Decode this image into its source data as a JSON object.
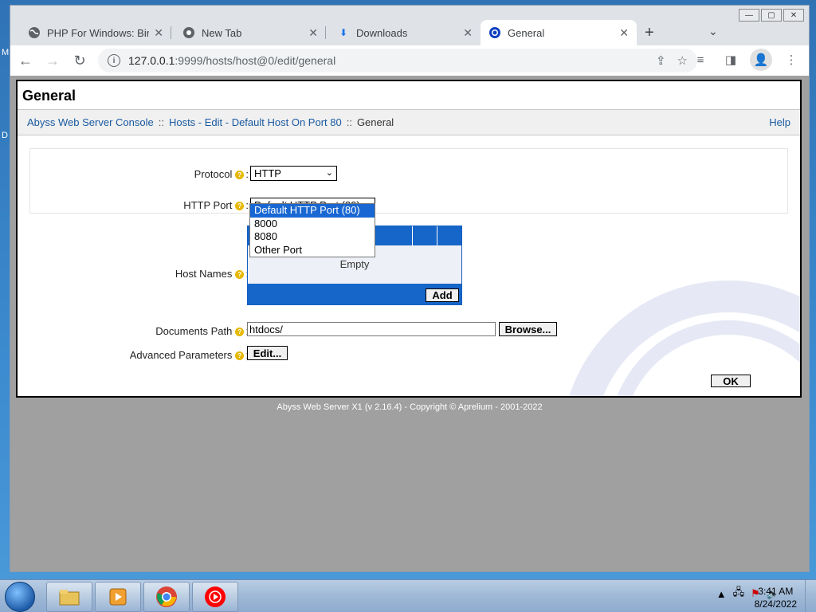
{
  "desktop": {
    "letters": [
      "M",
      "D"
    ]
  },
  "window_controls": {
    "minimize": "—",
    "maximize": "▢",
    "close": "✕"
  },
  "tabs": [
    {
      "title": "PHP For Windows: Bina",
      "icon": "globe-icon"
    },
    {
      "title": "New Tab",
      "icon": "chrome-icon"
    },
    {
      "title": "Downloads",
      "icon": "download-icon"
    },
    {
      "title": "General",
      "icon": "abyss-icon"
    }
  ],
  "tab_close": "✕",
  "new_tab": "+",
  "tab_menu": "⌄",
  "address": {
    "host": "127.0.0.1",
    "path": ":9999/hosts/host@0/edit/general"
  },
  "page": {
    "title": "General",
    "breadcrumb": {
      "console": "Abyss Web Server Console",
      "sep": "::",
      "hosts_edit": "Hosts - Edit - Default Host On Port 80",
      "current": "General",
      "help": "Help"
    },
    "labels": {
      "protocol": "Protocol",
      "http_port": "HTTP Port",
      "host_names": "Host Names",
      "documents_path": "Documents Path",
      "advanced_parameters": "Advanced Parameters",
      "colon": ":"
    },
    "help_mark": "?",
    "protocol_value": "HTTP",
    "http_port_value": "Default HTTP Port (80)",
    "port_options": [
      "Default HTTP Port (80)",
      "8000",
      "8080",
      "Other Port"
    ],
    "host_names_empty": "Empty",
    "add_button": "Add",
    "documents_path_value": "htdocs/",
    "browse_button": "Browse...",
    "edit_button": "Edit...",
    "ok_button": "OK",
    "footer": "Abyss Web Server X1 (v 2.16.4) - Copyright © Aprelium - 2001-2022"
  },
  "taskbar": {
    "apps": [
      "file-explorer-icon",
      "media-player-icon",
      "chrome-icon",
      "youtube-music-icon"
    ],
    "time": "3:41 AM",
    "date": "8/24/2022"
  }
}
